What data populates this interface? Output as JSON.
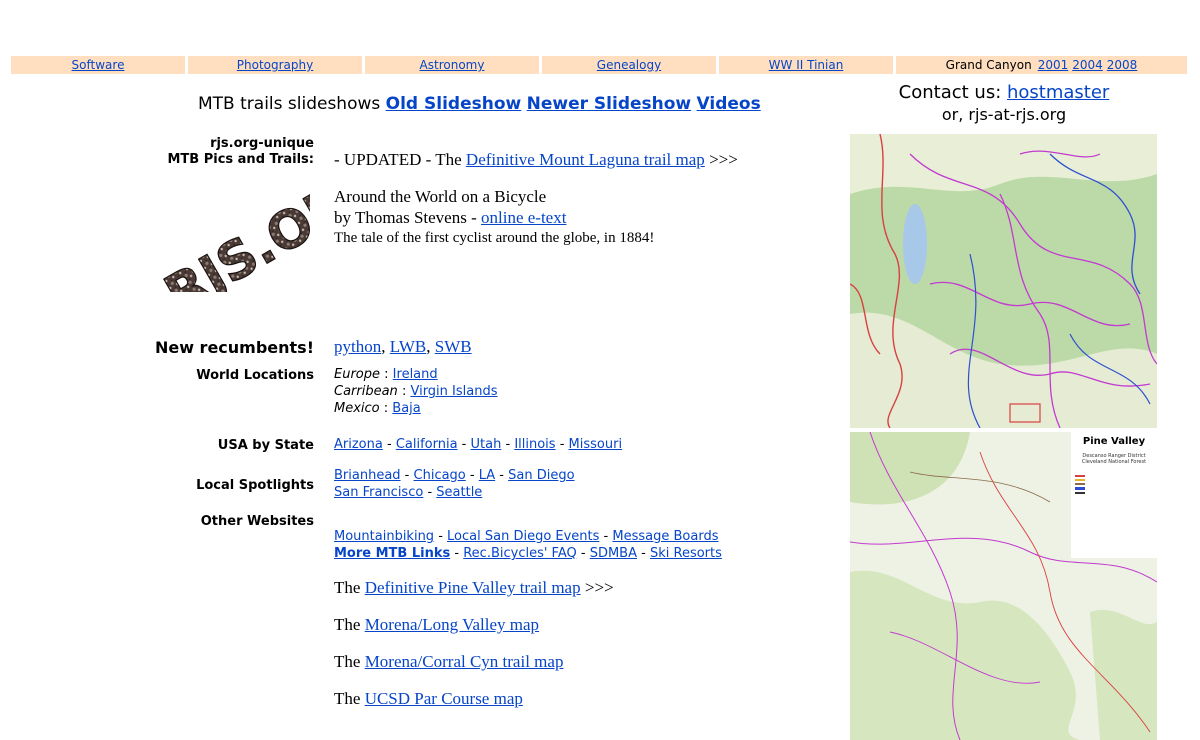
{
  "nav": {
    "items": [
      {
        "label": "Software"
      },
      {
        "label": "Photography"
      },
      {
        "label": "Astronomy"
      },
      {
        "label": "Genealogy"
      },
      {
        "label": "WW II Tinian"
      }
    ],
    "grand_canyon": {
      "label": "Grand Canyon",
      "years": [
        "2001",
        "2004",
        "2008"
      ]
    },
    "bg_color": "#ffdfbf"
  },
  "slideshows": {
    "prefix": "MTB trails slideshows",
    "links": [
      "Old Slideshow",
      "Newer Slideshow",
      "Videos"
    ]
  },
  "contact": {
    "prefix": "Contact us:",
    "link": "hostmaster",
    "alt": "or, rjs-at-rjs.org"
  },
  "labels": {
    "unique_line1": "rjs.org-unique",
    "unique_line2": "MTB Pics and Trails:",
    "new_recumbents": "New recumbents!",
    "world_locations": "World Locations",
    "usa_by_state": "USA by State",
    "local_spotlights": "Local Spotlights",
    "other_websites": "Other Websites"
  },
  "logo": {
    "text": "RJS.ORG"
  },
  "laguna": {
    "prefix": "- UPDATED -",
    "the": "The",
    "link": "Definitive Mount Laguna trail map",
    "suffix": ">>>"
  },
  "bicycle": {
    "title": "Around the World on a Bicycle",
    "by": "by Thomas Stevens -",
    "link": "online e-text",
    "tagline": "The tale of the first cyclist around the globe, in 1884!"
  },
  "recumbents": [
    "python",
    "LWB",
    "SWB"
  ],
  "world": [
    {
      "region": "Europe",
      "link": "Ireland"
    },
    {
      "region": "Carribean",
      "link": "Virgin Islands"
    },
    {
      "region": "Mexico",
      "link": "Baja"
    }
  ],
  "states": [
    "Arizona",
    "California",
    "Utah",
    "Illinois",
    "Missouri"
  ],
  "spotlights": {
    "row1": [
      "Brianhead",
      "Chicago",
      "LA",
      "San Diego"
    ],
    "row2": [
      "San Francisco",
      "Seattle"
    ]
  },
  "websites": {
    "row1": [
      "Mountainbiking",
      "Local San Diego Events",
      "Message Boards"
    ],
    "more": "More MTB Links",
    "row2": [
      "Rec.Bicycles' FAQ",
      "SDMBA",
      "Ski Resorts"
    ]
  },
  "maps_list": [
    {
      "the": "The",
      "link": "Definitive Pine Valley trail map",
      "suffix": ">>>"
    },
    {
      "the": "The",
      "link": "Morena/Long Valley map",
      "suffix": ""
    },
    {
      "the": "The",
      "link": "Morena/Corral Cyn trail map",
      "suffix": ""
    },
    {
      "the": "The",
      "link": "UCSD Par Course map",
      "suffix": ""
    }
  ],
  "map2_legend": {
    "title": "Pine Valley",
    "sub1": "Descanso Ranger District",
    "sub2": "Cleveland National Forest"
  }
}
